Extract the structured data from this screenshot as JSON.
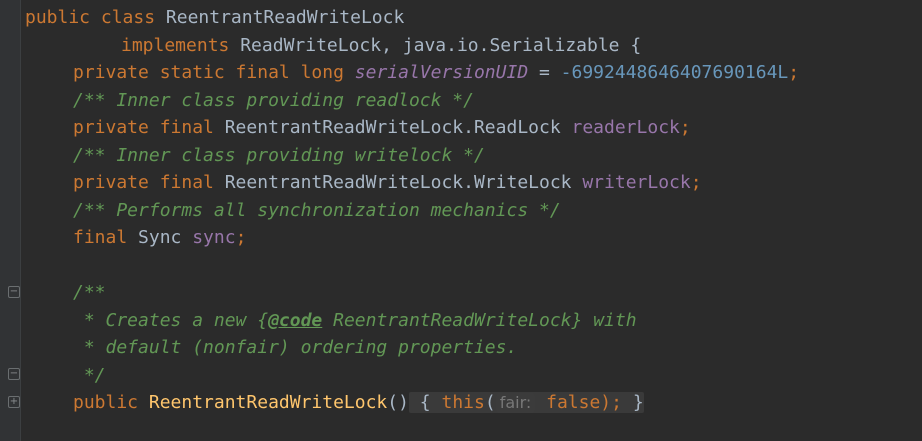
{
  "lines": {
    "l1": {
      "kw": "public class ",
      "name": "ReentrantReadWriteLock"
    },
    "l2": {
      "kw": "implements ",
      "rest": "ReadWriteLock, java.io.Serializable {"
    },
    "l3": {
      "kw": "private static final long ",
      "field": "serialVersionUID",
      "eq": " = ",
      "num": "-6992448646407690164L",
      "semi": ";"
    },
    "l4": {
      "doc": "/** Inner class providing readlock */"
    },
    "l5": {
      "kw": "private final ",
      "type": "ReentrantReadWriteLock.ReadLock ",
      "field": "readerLock",
      "semi": ";"
    },
    "l6": {
      "doc": "/** Inner class providing writelock */"
    },
    "l7": {
      "kw": "private final ",
      "type": "ReentrantReadWriteLock.WriteLock ",
      "field": "writerLock",
      "semi": ";"
    },
    "l8": {
      "doc": "/** Performs all synchronization mechanics */"
    },
    "l9": {
      "kw": "final ",
      "type": "Sync ",
      "field": "sync",
      "semi": ";"
    },
    "l10": {},
    "l11": {
      "doc": "/**"
    },
    "l12": {
      "pre": " * Creates a new {",
      "tag": "@code",
      "post": " ReentrantReadWriteLock} with"
    },
    "l13": {
      "doc": " * default (nonfair) ordering properties."
    },
    "l14": {
      "doc": " */"
    },
    "l15": {
      "kw": "public ",
      "method": "ReentrantReadWriteLock",
      "parens": "()",
      "open": " { ",
      "this": "this",
      "paren": "(",
      "hint": "fair:",
      "val": "false",
      "close": ");",
      "end": " }"
    }
  },
  "gutter": {
    "fold1": "−",
    "fold2": "−",
    "fold3": "+"
  }
}
